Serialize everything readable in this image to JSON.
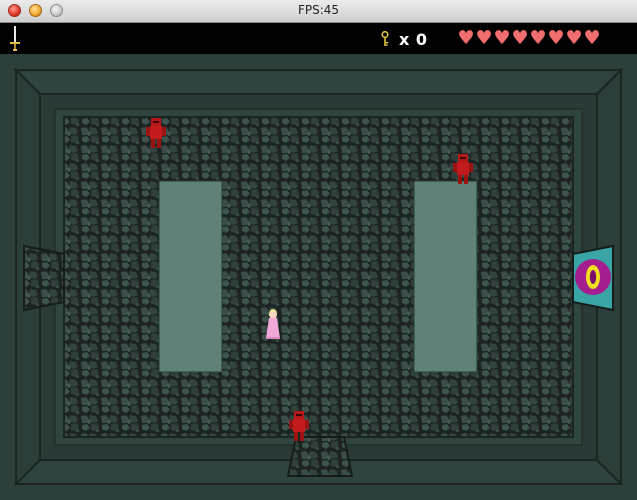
{
  "window": {
    "title": "FPS:45"
  },
  "hud": {
    "weapon_icon": "sword-icon",
    "key_icon": "key-icon",
    "key_count": "x 0",
    "hearts_total": 8,
    "heart_icon": "heart-icon",
    "heart_color": "#ef6f6f"
  },
  "room": {
    "floor_color": "#23302d",
    "wall_color": "#2f4340",
    "pillar_color": "#5f8178",
    "doors": [
      "west-door",
      "south-door",
      "east-door"
    ]
  },
  "entities": {
    "player": "princess",
    "enemies": [
      "red-knight",
      "red-knight",
      "red-knight"
    ],
    "portal": "magic-eye-portal"
  }
}
